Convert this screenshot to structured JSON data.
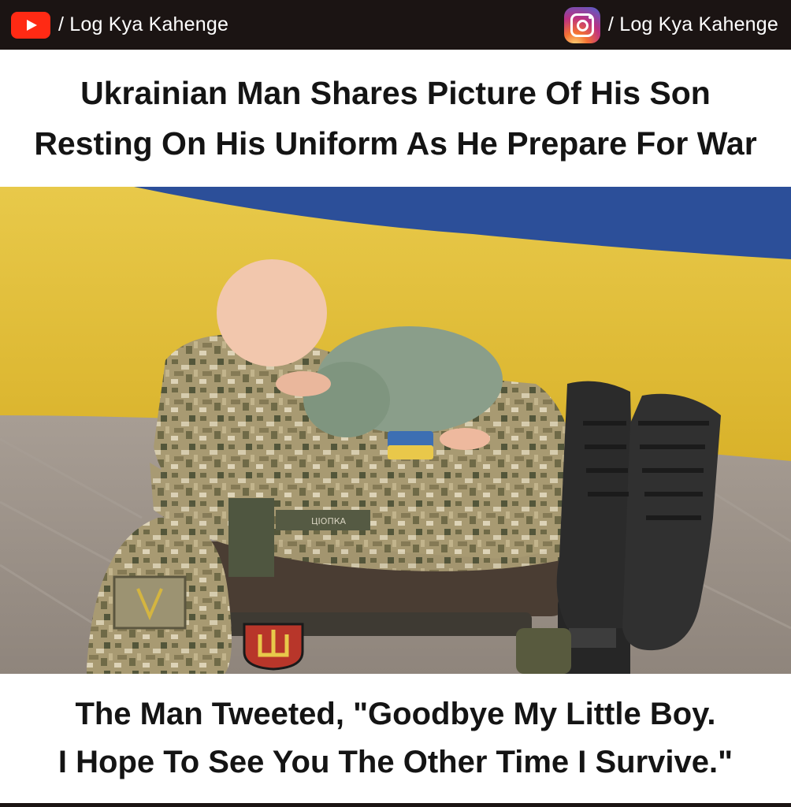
{
  "header": {
    "left_brand": {
      "icon": "youtube-icon",
      "text": "/ Log Kya Kahenge"
    },
    "right_brand": {
      "icon": "instagram-icon",
      "text": "/ Log Kya Kahenge"
    }
  },
  "headline": {
    "line1": "Ukrainian Man Shares Picture Of His Son",
    "line2": "Resting On His Uniform As He Prepare For War"
  },
  "photo": {
    "uniform_tag": "ЦІОПКА"
  },
  "caption": {
    "line1": "The Man Tweeted, \"Goodbye My Little Boy.",
    "line2": "I Hope To See You The Other Time I Survive.\""
  },
  "colors": {
    "bar": "#1b1413",
    "flag_blue": "#2c4f99",
    "flag_yellow": "#e5c23a",
    "youtube_red": "#ff2a14"
  }
}
